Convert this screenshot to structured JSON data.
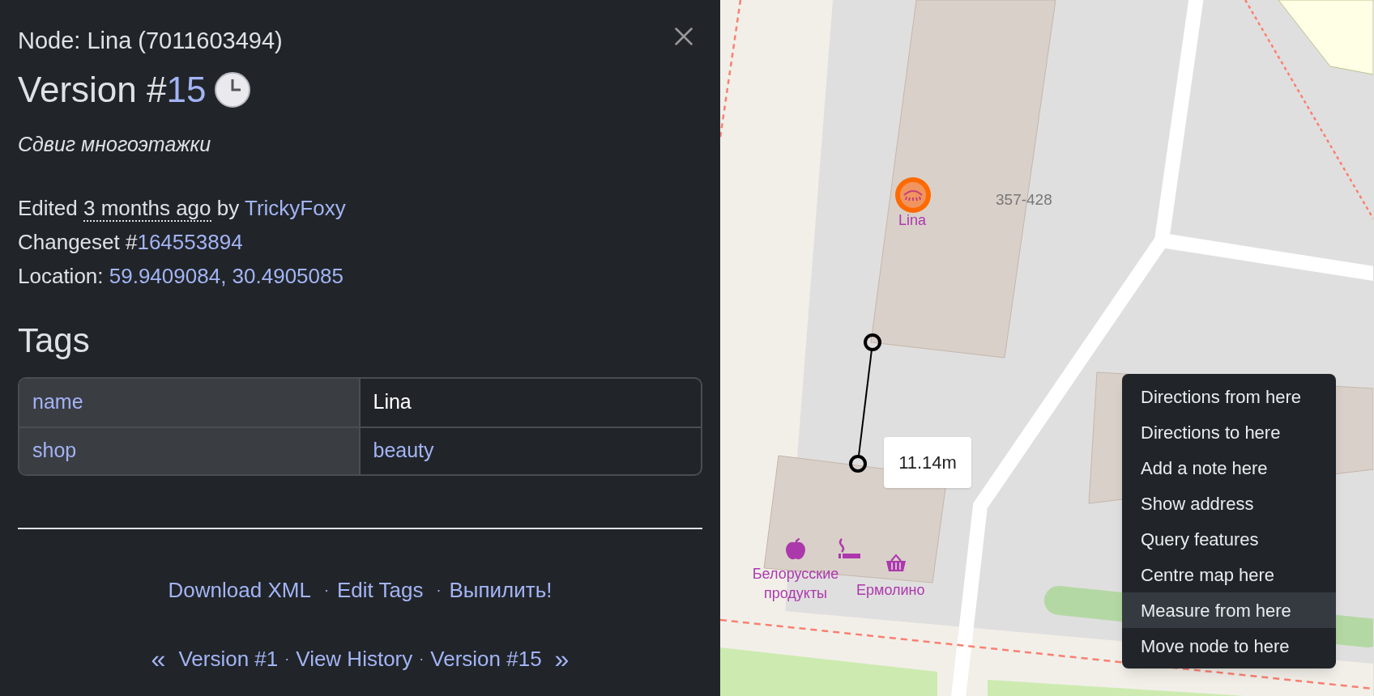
{
  "panel": {
    "title": "Node: Lina (7011603494)",
    "version_prefix": "Version #",
    "version_number": "15",
    "comment": "Сдвиг многоэтажки",
    "edited": {
      "prefix": "Edited",
      "time": "3 months ago",
      "by": "by",
      "user": "TrickyFoxy"
    },
    "changeset": {
      "label": "Changeset #",
      "number": "164553894"
    },
    "location": {
      "label": "Location:",
      "coords": "59.9409084, 30.4905085"
    },
    "tags_heading": "Tags",
    "tags": [
      {
        "key": "name",
        "value": "Lina",
        "link": false
      },
      {
        "key": "shop",
        "value": "beauty",
        "link": true
      }
    ],
    "actions": [
      {
        "label": "Download XML"
      },
      {
        "separator": "·",
        "label": "Edit Tags"
      },
      {
        "separator": "·",
        "label": "Выпилить!"
      }
    ],
    "nav": [
      {
        "kind": "arrow",
        "text": "«"
      },
      {
        "kind": "link",
        "text": "Version #1"
      },
      {
        "kind": "separator",
        "text": "·"
      },
      {
        "kind": "link",
        "text": "View History"
      },
      {
        "kind": "separator",
        "text": "·"
      },
      {
        "kind": "link",
        "text": "Version #15"
      },
      {
        "kind": "arrow",
        "text": "»"
      }
    ]
  },
  "map": {
    "poi_label": "Lina",
    "house_number": "357-428",
    "shop_labels": [
      "Белорусские продукты",
      "Ермолино"
    ],
    "measure": "11.14m"
  },
  "context_menu": {
    "items": [
      {
        "label": "Directions from here",
        "selected": false
      },
      {
        "label": "Directions to here",
        "selected": false
      },
      {
        "label": "Add a note here",
        "selected": false
      },
      {
        "label": "Show address",
        "selected": false
      },
      {
        "label": "Query features",
        "selected": false
      },
      {
        "label": "Centre map here",
        "selected": false
      },
      {
        "label": "Measure from here",
        "selected": true
      },
      {
        "label": "Move node to here",
        "selected": false
      }
    ]
  }
}
